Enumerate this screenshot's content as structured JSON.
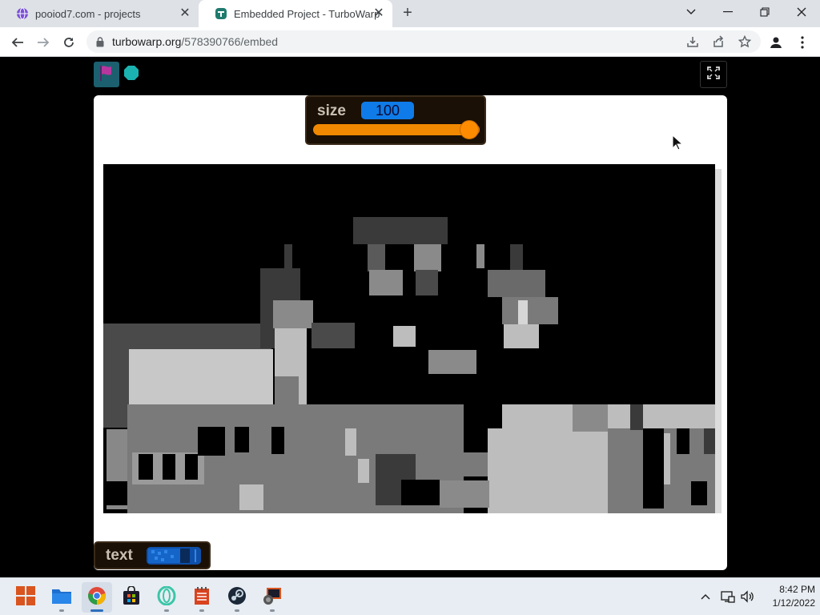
{
  "browser": {
    "tabs": [
      {
        "title": "pooiod7.com - projects",
        "icon": "globe-icon",
        "active": false
      },
      {
        "title": "Embedded Project - TurboWarp",
        "icon": "turbowarp-icon",
        "active": true
      }
    ],
    "url_host": "turbowarp.org",
    "url_path": "/578390766/embed"
  },
  "player": {
    "green_flag": "green-flag-icon",
    "stop": "stop-icon",
    "fullscreen": "fullscreen-icon"
  },
  "monitors": {
    "size": {
      "label": "size",
      "value": "100",
      "slider_level": 1.0
    },
    "text": {
      "label": "text",
      "value": ""
    }
  },
  "taskbar": {
    "apps": [
      "start-icon",
      "file-explorer-icon",
      "chrome-icon",
      "store-icon",
      "opera-icon",
      "notes-icon",
      "steam-icon",
      "app-icon"
    ],
    "time": "8:42 PM",
    "date": "1/12/2022"
  },
  "colors": {
    "slider": "#ff8c00",
    "value_box": "#0f7be8",
    "monitor_bg": "#1a1005"
  }
}
